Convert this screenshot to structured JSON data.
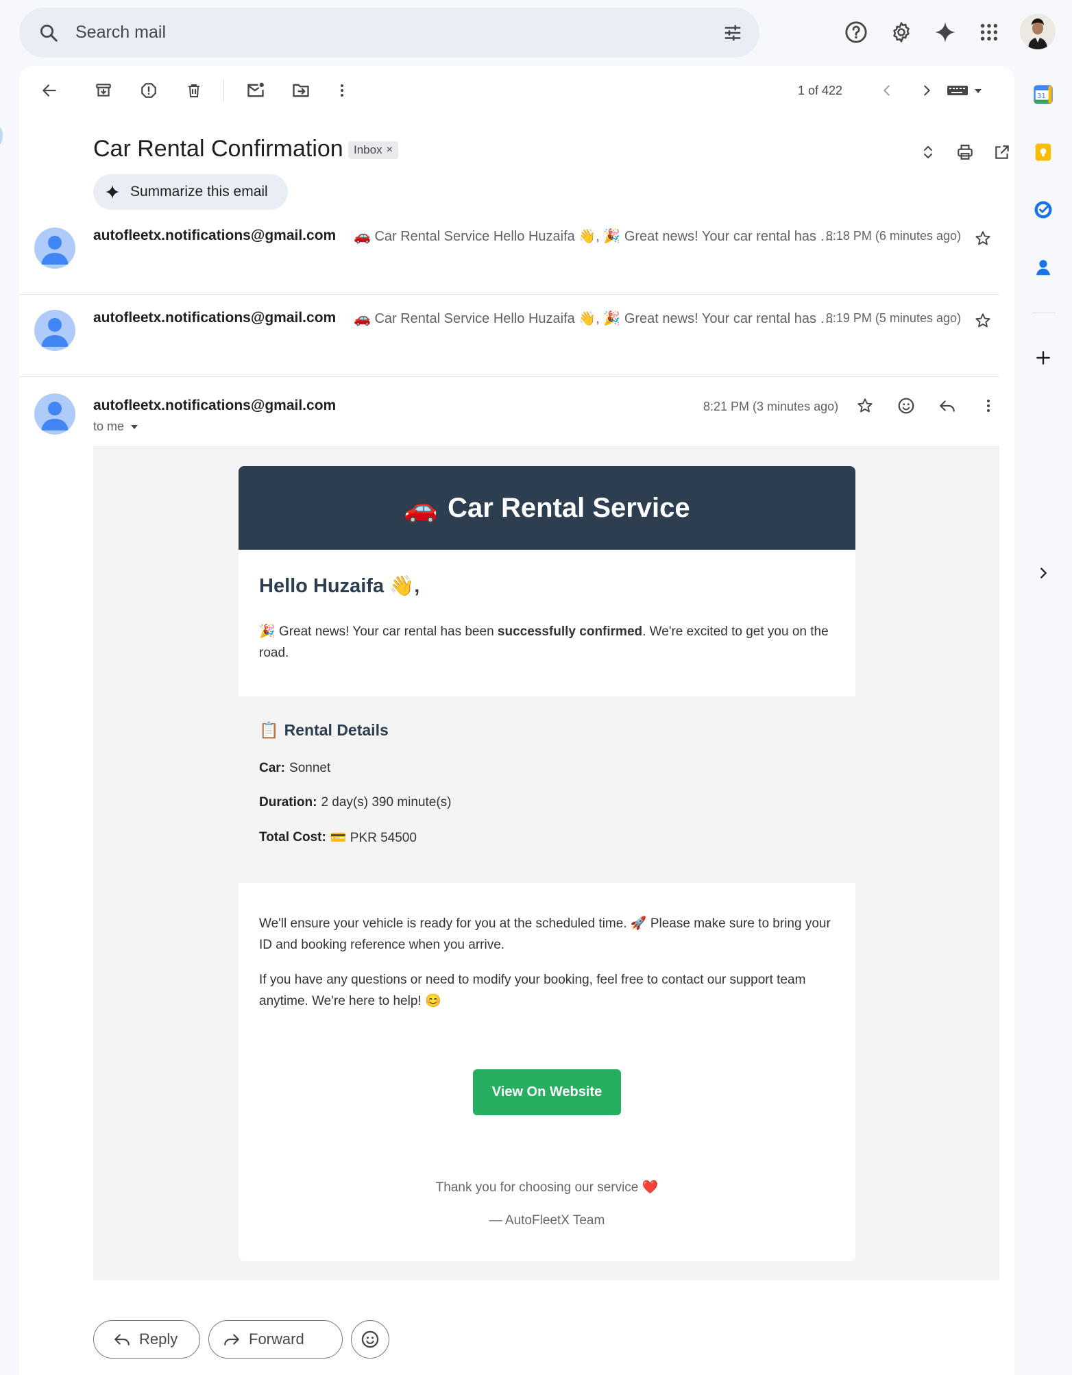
{
  "search": {
    "placeholder": "Search mail"
  },
  "toolbar": {
    "counter": "1 of 422"
  },
  "email": {
    "subject": "Car Rental Confirmation",
    "label": "Inbox",
    "summarize_label": "Summarize this email"
  },
  "thread": [
    {
      "sender": "autofleetx.notifications@gmail.com",
      "snippet": "🚗 Car Rental Service Hello Huzaifa 👋, 🎉 Great news! Your car rental has …",
      "time": "8:18 PM (6 minutes ago)"
    },
    {
      "sender": "autofleetx.notifications@gmail.com",
      "snippet": "🚗 Car Rental Service Hello Huzaifa 👋, 🎉 Great news! Your car rental has …",
      "time": "8:19 PM (5 minutes ago)"
    }
  ],
  "expanded": {
    "sender": "autofleetx.notifications@gmail.com",
    "to": "to me",
    "time": "8:21 PM (3 minutes ago)"
  },
  "message": {
    "header_emoji": "🚗",
    "header_title": "Car Rental Service",
    "greeting": "Hello Huzaifa 👋,",
    "intro_prefix": "🎉 Great news! Your car rental has been ",
    "intro_bold": "successfully confirmed",
    "intro_suffix": ". We're excited to get you on the road.",
    "details_emoji": "📋",
    "details_title": "Rental Details",
    "car_label": "Car:",
    "car_value": "Sonnet",
    "duration_label": "Duration:",
    "duration_value": "2 day(s) 390 minute(s)",
    "cost_label": "Total Cost:",
    "cost_value": "💳 PKR 54500",
    "para1": "We'll ensure your vehicle is ready for you at the scheduled time. 🚀 Please make sure to bring your ID and booking reference when you arrive.",
    "para2": "If you have any questions or need to modify your booking, feel free to contact our support team anytime. We're here to help! 😊",
    "cta": "View On Website",
    "thanks": "Thank you for choosing our service ❤️",
    "signature": "— AutoFleetX Team"
  },
  "actions": {
    "reply": "Reply",
    "forward": "Forward"
  },
  "colors": {
    "header_bg": "#2c3e50",
    "cta_bg": "#27ae60",
    "avatar_bg": "#aecbfa",
    "avatar_fg": "#4285f4"
  }
}
